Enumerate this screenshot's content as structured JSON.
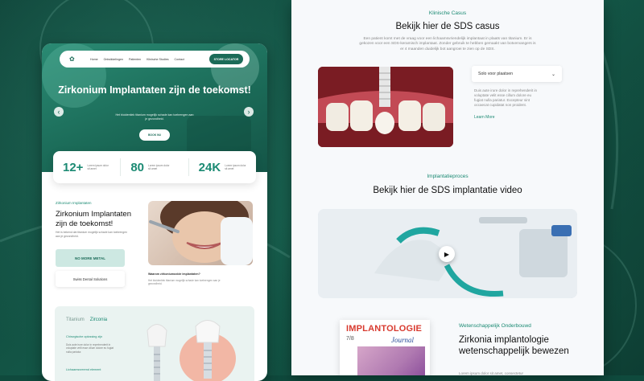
{
  "left_page": {
    "nav": {
      "logo_icon": "flower-logo-icon",
      "links": [
        "Home",
        "Ontwikkelingen",
        "Patienten",
        "Klinische Studies",
        "Contact"
      ],
      "cta": "STORE LOCATOR"
    },
    "hero": {
      "title": "Zirkonium Implantaten zijn de toekomst!",
      "subtitle": "Het bioidentiek titanium mogelijk schade kan toebrengen aan je gezondheid.",
      "button": "BOOK NU",
      "prev_icon": "chevron-left-icon",
      "next_icon": "chevron-right-icon"
    },
    "stats": [
      {
        "value": "12+",
        "label": "Lorem ipsum dolor sit amet"
      },
      {
        "value": "80",
        "label": "Lorem ipsum dolor sit amet"
      },
      {
        "value": "24K",
        "label": "Lorem ipsum dolor sit amet"
      }
    ],
    "section": {
      "tag": "Zirkonium Implantaten",
      "heading": "Zirkonium Implantaten zijn de toekomst!",
      "paragraph": "Het is bekend dat titanium mogelijk schade kan toebrengen aan je gezondheid.",
      "badge_primary": "NO MORE METAL",
      "badge_secondary": "Swiss Dental Solutions",
      "caption_title": "Waarom zirkoniumoxide implantaten?",
      "caption_text": "Het bioidentiek titanium mogelijk schade kan toebrengen aan je gezondheid."
    },
    "bottom_card": {
      "tab_inactive": "Titanium",
      "tab_active": "Zirconia",
      "item1": "Chirurgische oplossing zijn",
      "paragraph": "Duis aute irure dolor in reprehenderit in voluptate velit esse cillum dolore eu fugiat nulla pariatur.",
      "item2": "Lichaamsvreemd element"
    }
  },
  "right_page": {
    "case": {
      "tag": "Klinische Casus",
      "heading": "Bekijk hier de SDS casus",
      "paragraph": "Een patient komt met de vraag voor een lichaamsvriendelijk implantaat in plaats van titanium. Er is gekozen voor een SDS-keramisch implantaat. Zonder gebruik te hebben gemaakt van botvervangers is er 4 maanden duidelijk bot aangroei te zien op de SDS.",
      "select_value": "Solo voor plaatsen",
      "select_icon": "chevron-down-icon",
      "side_text": "Duis aute irure dolor in reprehenderit in voluptate velit esse cillum dolore eu fugiat nulla pariatur. Excepteur sint occaecat cupidatat non proident.",
      "link": "Learn More"
    },
    "video": {
      "tag": "Implantatieproces",
      "heading": "Bekijk hier de SDS implantatie video",
      "play_icon": "play-icon"
    },
    "research": {
      "journal_title": "IMPLANTOLOGIE",
      "journal_issue": "7/8",
      "journal_subtitle": "Journal",
      "tag": "Wetenschappelijk Onderbouwd",
      "heading": "Zirkonia implantologie wetenschappelijk bewezen",
      "paragraph": "Lorem ipsum dolor sit amet, consectetur"
    }
  },
  "colors": {
    "accent": "#1b8a73",
    "hero": "#1b6b58",
    "background": "#0f4a3d"
  }
}
